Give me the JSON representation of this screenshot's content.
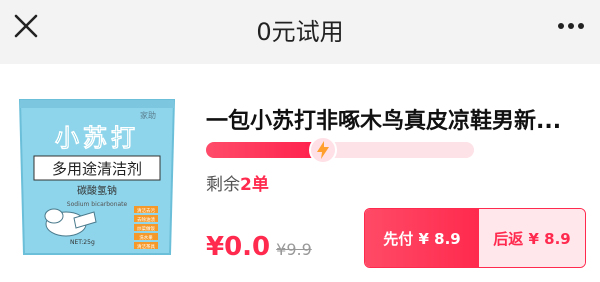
{
  "nav": {
    "title": "0元试用",
    "close_icon": "close-icon",
    "more_icon": "more-icon"
  },
  "product": {
    "title": "一包小苏打非啄木鸟真皮凉鞋男新...",
    "remaining_label": "剩余",
    "remaining_count": "2单",
    "progress": 0.43,
    "price_now": "¥0.0",
    "price_original": "¥9.9",
    "pay_first_label": "先付 ¥ 8.9",
    "refund_label": "后返 ¥ 8.9"
  },
  "package": {
    "brand_top": "家助",
    "name": "小苏打",
    "subtitle": "多用途清洁剂",
    "chem_name": "碳酸氢钠",
    "chem_en": "Sodium bicarbonate",
    "net_weight": "NET:25g",
    "features": [
      "清洁去污",
      "去除油渍",
      "炒菜做饭",
      "洗水果",
      "清洁茶具"
    ]
  },
  "colors": {
    "accent": "#ff2a4e",
    "package_blue": "#8ed4ea"
  }
}
